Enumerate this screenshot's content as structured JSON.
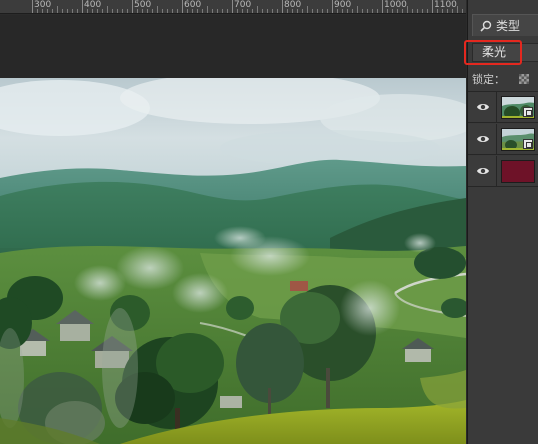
{
  "ruler": {
    "labels": [
      "300",
      "400",
      "500",
      "600",
      "700",
      "800",
      "900",
      "1000",
      "1100"
    ]
  },
  "layers_panel": {
    "filter_label": "类型",
    "filter_icon": "search-icon",
    "blend_mode": "柔光",
    "lock_label": "锁定：",
    "lock_icon": "lock-transparent-pixels-icon",
    "layers": [
      {
        "visible": true,
        "thumb": "landscape-photo",
        "smart_object": true
      },
      {
        "visible": true,
        "thumb": "landscape-photo",
        "smart_object": true
      },
      {
        "visible": true,
        "thumb": "solid-color",
        "fill": "#6e1228"
      }
    ]
  },
  "colors": {
    "highlight_box": "#e4281f",
    "canvas_edge": "#8c1c28",
    "panel_bg": "#3a3a3a"
  }
}
